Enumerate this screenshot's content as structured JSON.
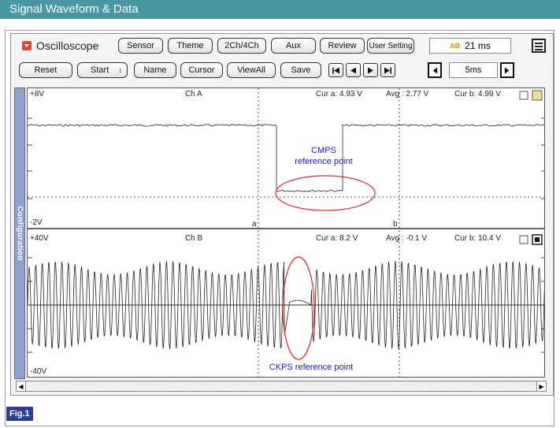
{
  "page_title": "Signal Waveform & Data",
  "figure_label": "Fig.1",
  "app": {
    "title": "Oscilloscope",
    "top_buttons": [
      "Sensor",
      "Theme",
      "2Ch/4Ch",
      "Aux",
      "Review",
      "User Setting"
    ],
    "time_value": "21 ms",
    "time_icon": "AB"
  },
  "toolbar": {
    "reset": "Reset",
    "start": "Start",
    "name": "Name",
    "cursor": "Cursor",
    "viewall": "ViewAll",
    "save": "Save",
    "zoom_value": "5ms"
  },
  "side_tab": "Configuration",
  "channel_a": {
    "label": "Ch A",
    "top_scale": "+8V",
    "bottom_scale": "-2V",
    "cur_a": "Cur a: 4.93 V",
    "avg": "Avg  : 2.77 V",
    "cur_b": "Cur b: 4.99 V",
    "annotation_line1": "CMPS",
    "annotation_line2": "reference point",
    "cursor_a": "a",
    "cursor_b": "b"
  },
  "channel_b": {
    "label": "Ch B",
    "top_scale": "+40V",
    "bottom_scale": "-40V",
    "cur_a": "Cur a: 8.2 V",
    "avg": "Avg  : -0.1 V",
    "cur_b": "Cur b: 10.4 V",
    "annotation": "CKPS reference point"
  },
  "colors": {
    "title_bar": "#4a97a4",
    "annotation_text": "#1a1acd",
    "annotation_ellipse": "#e23030",
    "config_tab": "#8ea1c8",
    "figure_badge": "#2c3f90"
  }
}
